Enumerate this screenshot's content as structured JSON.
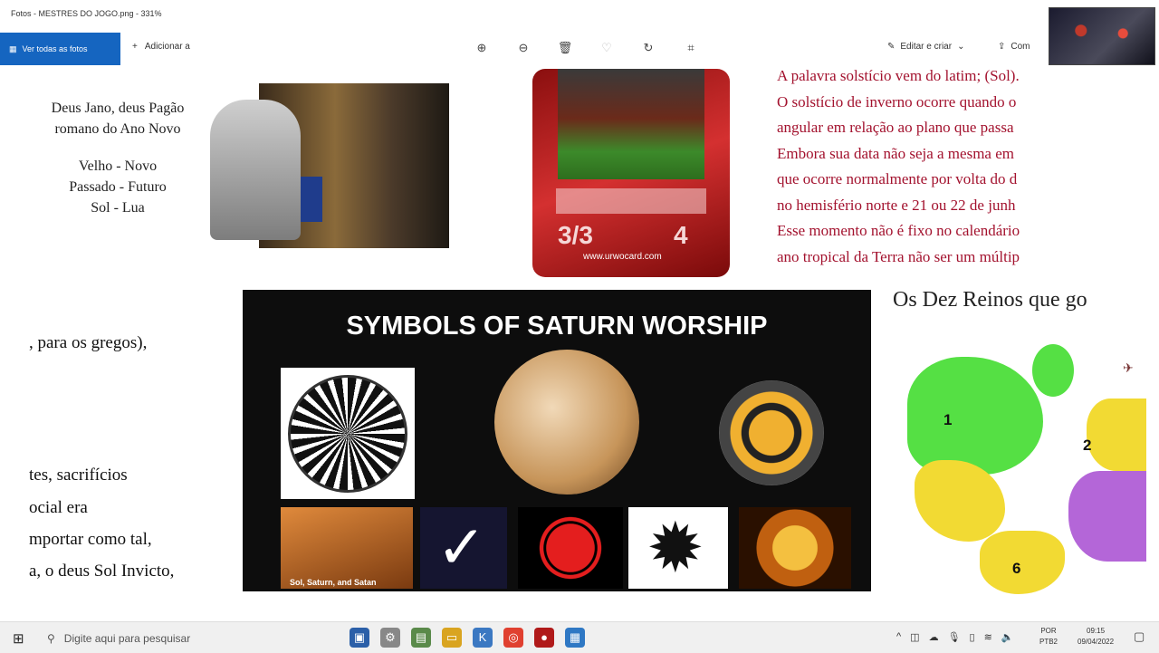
{
  "window": {
    "title": "Fotos - MESTRES DO JOGO.png - 331%"
  },
  "toolbar": {
    "all_photos": "Ver todas as fotos",
    "add_to": "Adicionar a",
    "edit_create": "Editar e criar",
    "share": "Com"
  },
  "document": {
    "jano": {
      "lines": [
        "Deus Jano, deus Pagão",
        "romano do Ano Novo",
        "",
        "Velho - Novo",
        "Passado - Futuro",
        "Sol - Lua"
      ]
    },
    "card": {
      "pt": "3/3",
      "cost": "4",
      "url": "www.urwocard.com"
    },
    "solstice_lines": [
      "A palavra solstício vem do latim; (Sol).",
      "O solstício de inverno ocorre quando o",
      "angular em relação ao plano que passa",
      "Embora sua data não seja a mesma em",
      "que ocorre normalmente por volta do d",
      "no hemisfério norte e 21 ou 22 de junh",
      "Esse momento não é fixo no calendário",
      "ano tropical da Terra não ser um múltip"
    ],
    "poster": {
      "title": "SYMBOLS OF SATURN WORSHIP",
      "caption": "Sol, Saturn, and Satan"
    },
    "reinos_title": "Os Dez Reinos que go",
    "map_labels": [
      "1",
      "2",
      "6"
    ],
    "left_fragments": [
      ", para os gregos),",
      "tes, sacrifícios",
      "ocial era",
      "mportar como tal,",
      "a, o deus Sol Invicto,"
    ]
  },
  "taskbar": {
    "search_placeholder": "Digite aqui para pesquisar",
    "lang": [
      "POR",
      "PTB2"
    ],
    "time": "09:15",
    "date": "09/04/2022"
  },
  "icons": {
    "zoom_in": "zoom-in-icon",
    "zoom_out": "zoom-out-icon",
    "delete": "trash-icon",
    "favorite": "heart-icon",
    "rotate": "rotate-icon",
    "crop": "crop-icon"
  },
  "colors": {
    "accent": "#1565c0",
    "solstice_text": "#a3122e",
    "map_green": "#55e044",
    "map_yellow": "#f2da33"
  }
}
